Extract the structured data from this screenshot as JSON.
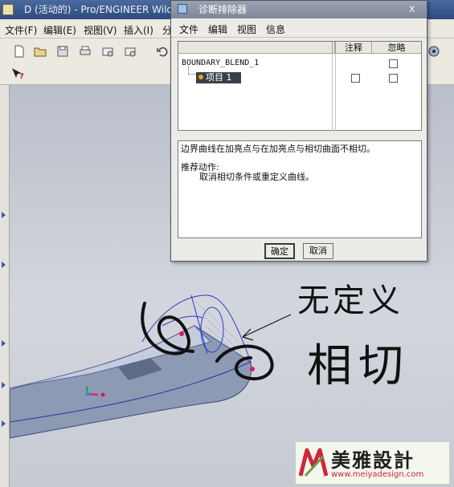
{
  "app": {
    "title": "D (活动的) - Pro/ENGINEER Wild",
    "menu": [
      "文件(F)",
      "编辑(E)",
      "视图(V)",
      "插入(I)",
      "分"
    ]
  },
  "dialog": {
    "title": "诊断排除器",
    "close_glyph": "x",
    "menu": [
      "文件",
      "编辑",
      "视图",
      "信息"
    ],
    "table": {
      "col_note": "注释",
      "col_ignore": "忽略",
      "root": "BOUNDARY_BLEND_1",
      "child": "项目 1"
    },
    "message": {
      "error": "边界曲线在加亮点与在加亮点与相切曲面不相切。",
      "action_title": "推荐动作:",
      "action": "取消相切条件或重定义曲线。"
    },
    "ok_label": "确定",
    "cancel_label": "取消"
  },
  "annotations": {
    "line1": "无定义",
    "line2": "相切"
  },
  "watermark": {
    "brand": "美雅設計",
    "url": "www.meiyadesign.com"
  },
  "colors": {
    "dialog_title_bg": "#8a93a4",
    "highlight": "#3a3f49",
    "annotation_ink": "#111111",
    "part_surface": "#8593b0",
    "watermark_red": "#d0263a",
    "watermark_green": "#6ba04a"
  }
}
